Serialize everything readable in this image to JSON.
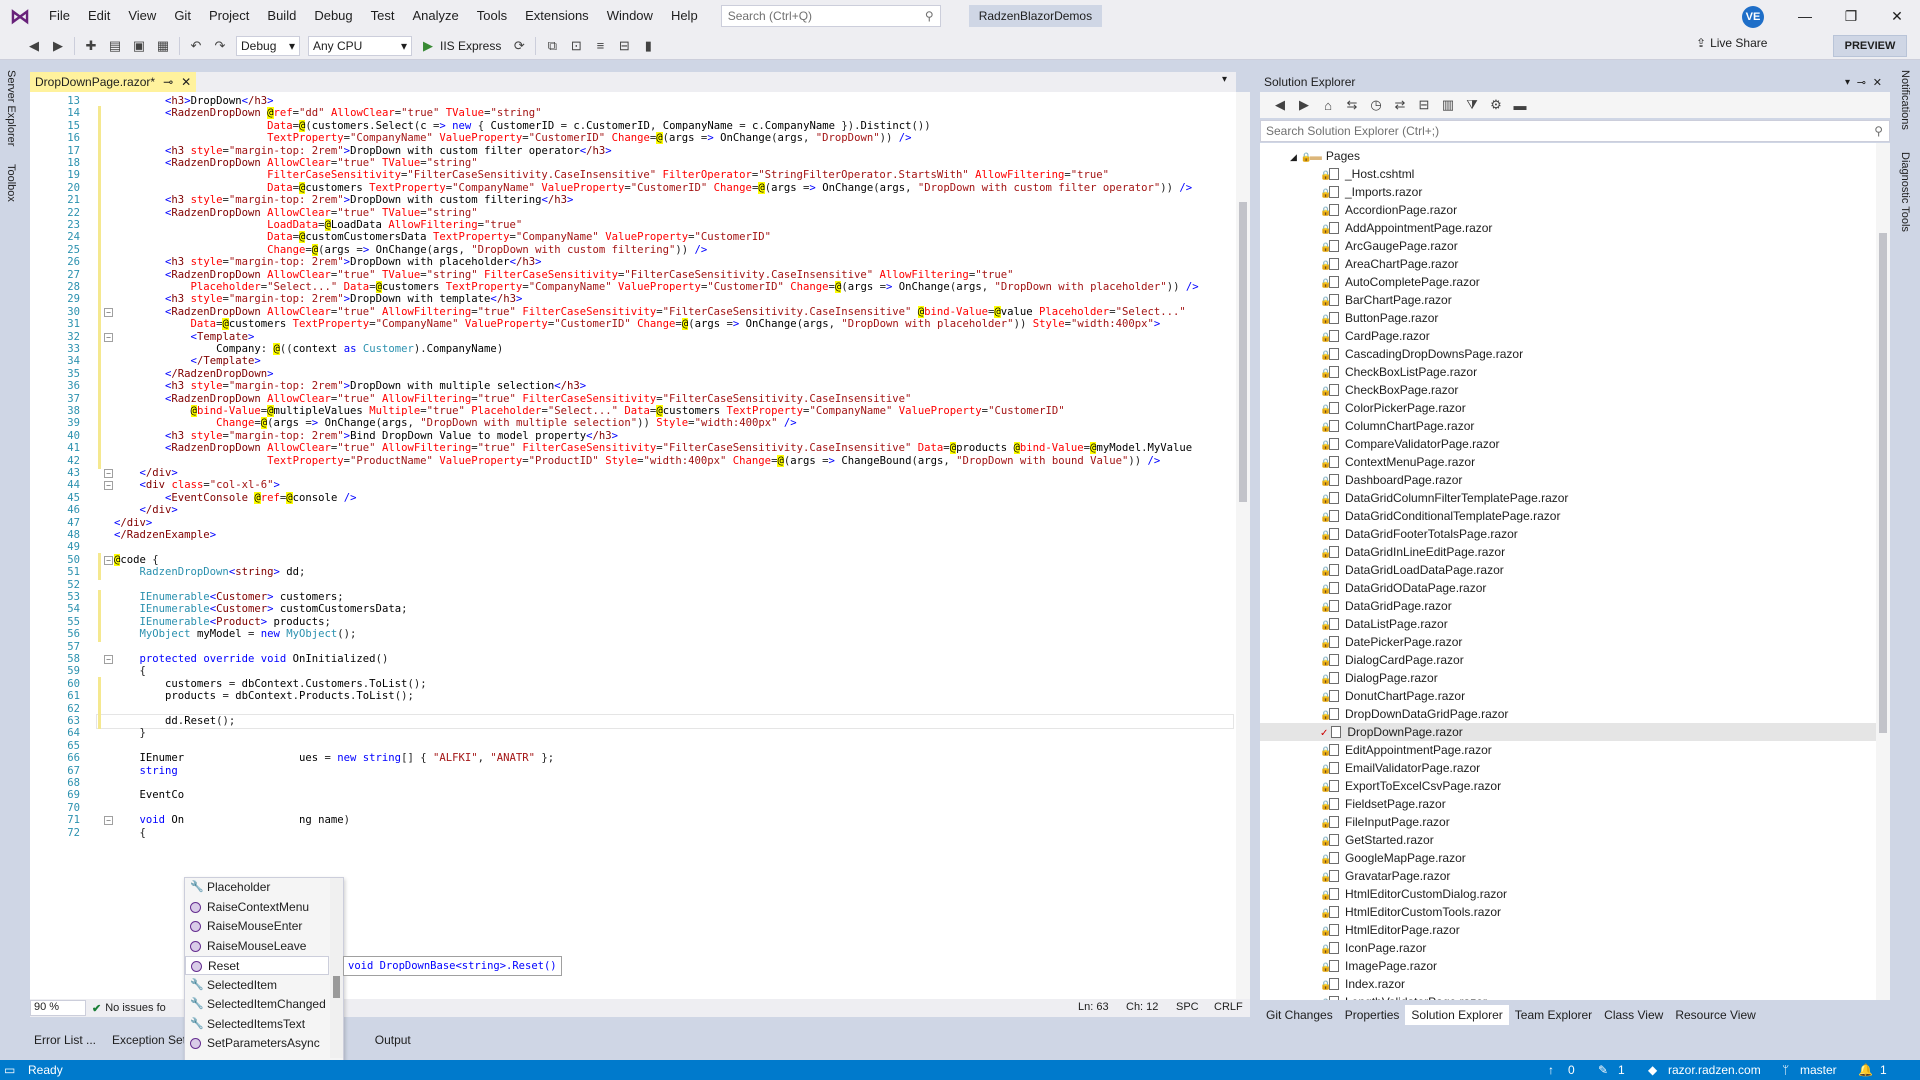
{
  "menu": {
    "items": [
      "File",
      "Edit",
      "View",
      "Git",
      "Project",
      "Build",
      "Debug",
      "Test",
      "Analyze",
      "Tools",
      "Extensions",
      "Window",
      "Help"
    ],
    "search_placeholder": "Search (Ctrl+Q)",
    "solution_name": "RadzenBlazorDemos",
    "user_initials": "VE"
  },
  "toolbar": {
    "config": "Debug",
    "platform": "Any CPU",
    "run_target": "IIS Express",
    "live_share": "Live Share",
    "preview": "PREVIEW"
  },
  "left_strip": {
    "tabs": [
      "Server Explorer",
      "Toolbox"
    ]
  },
  "right_strip": {
    "tabs": [
      "Notifications",
      "Diagnostic Tools"
    ]
  },
  "editor": {
    "tab_title": "DropDownPage.razor*",
    "zoom": "90 %",
    "issues": "No issues fo",
    "ln": "Ln: 63",
    "ch": "Ch: 12",
    "ins": "SPC",
    "eol": "CRLF",
    "lines": [
      {
        "n": "13",
        "t": "        <h3>DropDown</h3>"
      },
      {
        "n": "14",
        "t": "        <RadzenDropDown @ref=\"dd\" AllowClear=\"true\" TValue=\"string\""
      },
      {
        "n": "15",
        "t": "                        Data=@(customers.Select(c => new { CustomerID = c.CustomerID, CompanyName = c.CompanyName }).Distinct())"
      },
      {
        "n": "16",
        "t": "                        TextProperty=\"CompanyName\" ValueProperty=\"CustomerID\" Change=@(args => OnChange(args, \"DropDown\")) />"
      },
      {
        "n": "17",
        "t": "        <h3 style=\"margin-top: 2rem\">DropDown with custom filter operator</h3>"
      },
      {
        "n": "18",
        "t": "        <RadzenDropDown AllowClear=\"true\" TValue=\"string\""
      },
      {
        "n": "19",
        "t": "                        FilterCaseSensitivity=\"FilterCaseSensitivity.CaseInsensitive\" FilterOperator=\"StringFilterOperator.StartsWith\" AllowFiltering=\"true\""
      },
      {
        "n": "20",
        "t": "                        Data=@customers TextProperty=\"CompanyName\" ValueProperty=\"CustomerID\" Change=@(args => OnChange(args, \"DropDown with custom filter operator\")) />"
      },
      {
        "n": "21",
        "t": "        <h3 style=\"margin-top: 2rem\">DropDown with custom filtering</h3>"
      },
      {
        "n": "22",
        "t": "        <RadzenDropDown AllowClear=\"true\" TValue=\"string\""
      },
      {
        "n": "23",
        "t": "                        LoadData=@LoadData AllowFiltering=\"true\""
      },
      {
        "n": "24",
        "t": "                        Data=@customCustomersData TextProperty=\"CompanyName\" ValueProperty=\"CustomerID\""
      },
      {
        "n": "25",
        "t": "                        Change=@(args => OnChange(args, \"DropDown with custom filtering\")) />"
      },
      {
        "n": "26",
        "t": "        <h3 style=\"margin-top: 2rem\">DropDown with placeholder</h3>"
      },
      {
        "n": "27",
        "t": "        <RadzenDropDown AllowClear=\"true\" TValue=\"string\" FilterCaseSensitivity=\"FilterCaseSensitivity.CaseInsensitive\" AllowFiltering=\"true\""
      },
      {
        "n": "28",
        "t": "            Placeholder=\"Select...\" Data=@customers TextProperty=\"CompanyName\" ValueProperty=\"CustomerID\" Change=@(args => OnChange(args, \"DropDown with placeholder\")) />"
      },
      {
        "n": "29",
        "t": "        <h3 style=\"margin-top: 2rem\">DropDown with template</h3>"
      },
      {
        "n": "30",
        "t": "        <RadzenDropDown AllowClear=\"true\" AllowFiltering=\"true\" FilterCaseSensitivity=\"FilterCaseSensitivity.CaseInsensitive\" @bind-Value=@value Placeholder=\"Select...\""
      },
      {
        "n": "31",
        "t": "            Data=@customers TextProperty=\"CompanyName\" ValueProperty=\"CustomerID\" Change=@(args => OnChange(args, \"DropDown with placeholder\")) Style=\"width:400px\">"
      },
      {
        "n": "32",
        "t": "            <Template>"
      },
      {
        "n": "33",
        "t": "                Company: @((context as Customer).CompanyName)"
      },
      {
        "n": "34",
        "t": "            </Template>"
      },
      {
        "n": "35",
        "t": "        </RadzenDropDown>"
      },
      {
        "n": "36",
        "t": "        <h3 style=\"margin-top: 2rem\">DropDown with multiple selection</h3>"
      },
      {
        "n": "37",
        "t": "        <RadzenDropDown AllowClear=\"true\" AllowFiltering=\"true\" FilterCaseSensitivity=\"FilterCaseSensitivity.CaseInsensitive\""
      },
      {
        "n": "38",
        "t": "            @bind-Value=@multipleValues Multiple=\"true\" Placeholder=\"Select...\" Data=@customers TextProperty=\"CompanyName\" ValueProperty=\"CustomerID\""
      },
      {
        "n": "39",
        "t": "                Change=@(args => OnChange(args, \"DropDown with multiple selection\")) Style=\"width:400px\" />"
      },
      {
        "n": "40",
        "t": "        <h3 style=\"margin-top: 2rem\">Bind DropDown Value to model property</h3>"
      },
      {
        "n": "41",
        "t": "        <RadzenDropDown AllowClear=\"true\" AllowFiltering=\"true\" FilterCaseSensitivity=\"FilterCaseSensitivity.CaseInsensitive\" Data=@products @bind-Value=@myModel.MyValue"
      },
      {
        "n": "42",
        "t": "                        TextProperty=\"ProductName\" ValueProperty=\"ProductID\" Style=\"width:400px\" Change=@(args => ChangeBound(args, \"DropDown with bound Value\")) />"
      },
      {
        "n": "43",
        "t": "    </div>"
      },
      {
        "n": "44",
        "t": "    <div class=\"col-xl-6\">"
      },
      {
        "n": "45",
        "t": "        <EventConsole @ref=@console />"
      },
      {
        "n": "46",
        "t": "    </div>"
      },
      {
        "n": "47",
        "t": "</div>"
      },
      {
        "n": "48",
        "t": "</RadzenExample>"
      },
      {
        "n": "49",
        "t": ""
      },
      {
        "n": "50",
        "t": "@code {"
      },
      {
        "n": "51",
        "t": "    RadzenDropDown<string> dd;"
      },
      {
        "n": "52",
        "t": ""
      },
      {
        "n": "53",
        "t": "    IEnumerable<Customer> customers;"
      },
      {
        "n": "54",
        "t": "    IEnumerable<Customer> customCustomersData;"
      },
      {
        "n": "55",
        "t": "    IEnumerable<Product> products;"
      },
      {
        "n": "56",
        "t": "    MyObject myModel = new MyObject();"
      },
      {
        "n": "57",
        "t": ""
      },
      {
        "n": "58",
        "t": "    protected override void OnInitialized()"
      },
      {
        "n": "59",
        "t": "    {"
      },
      {
        "n": "60",
        "t": "        customers = dbContext.Customers.ToList();"
      },
      {
        "n": "61",
        "t": "        products = dbContext.Products.ToList();"
      },
      {
        "n": "62",
        "t": ""
      },
      {
        "n": "63",
        "t": "        dd.Reset();"
      },
      {
        "n": "64",
        "t": "    }"
      },
      {
        "n": "65",
        "t": ""
      },
      {
        "n": "66",
        "t": "    IEnumer                  ues = new string[] { \"ALFKI\", \"ANATR\" };"
      },
      {
        "n": "67",
        "t": "    string"
      },
      {
        "n": "68",
        "t": ""
      },
      {
        "n": "69",
        "t": "    EventCo"
      },
      {
        "n": "70",
        "t": ""
      },
      {
        "n": "71",
        "t": "    void On                  ng name)"
      },
      {
        "n": "72",
        "t": "    {"
      }
    ]
  },
  "intellisense": {
    "items": [
      "Placeholder",
      "RaiseContextMenu",
      "RaiseMouseEnter",
      "RaiseMouseLeave",
      "Reset",
      "SelectedItem",
      "SelectedItemChanged",
      "SelectedItemsText",
      "SetParametersAsync"
    ],
    "tooltip": "void DropDownBase<string>.Reset()"
  },
  "bottom_tabs": [
    "Error List ...",
    "Exception Settin",
    "Output"
  ],
  "solution_explorer": {
    "title": "Solution Explorer",
    "search_placeholder": "Search Solution Explorer (Ctrl+;)",
    "folder": "Pages",
    "files": [
      "_Host.cshtml",
      "_Imports.razor",
      "AccordionPage.razor",
      "AddAppointmentPage.razor",
      "ArcGaugePage.razor",
      "AreaChartPage.razor",
      "AutoCompletePage.razor",
      "BarChartPage.razor",
      "ButtonPage.razor",
      "CardPage.razor",
      "CascadingDropDownsPage.razor",
      "CheckBoxListPage.razor",
      "CheckBoxPage.razor",
      "ColorPickerPage.razor",
      "ColumnChartPage.razor",
      "CompareValidatorPage.razor",
      "ContextMenuPage.razor",
      "DashboardPage.razor",
      "DataGridColumnFilterTemplatePage.razor",
      "DataGridConditionalTemplatePage.razor",
      "DataGridFooterTotalsPage.razor",
      "DataGridInLineEditPage.razor",
      "DataGridLoadDataPage.razor",
      "DataGridODataPage.razor",
      "DataGridPage.razor",
      "DataListPage.razor",
      "DatePickerPage.razor",
      "DialogCardPage.razor",
      "DialogPage.razor",
      "DonutChartPage.razor",
      "DropDownDataGridPage.razor",
      "DropDownPage.razor",
      "EditAppointmentPage.razor",
      "EmailValidatorPage.razor",
      "ExportToExcelCsvPage.razor",
      "FieldsetPage.razor",
      "FileInputPage.razor",
      "GetStarted.razor",
      "GoogleMapPage.razor",
      "GravatarPage.razor",
      "HtmlEditorCustomDialog.razor",
      "HtmlEditorCustomTools.razor",
      "HtmlEditorPage.razor",
      "IconPage.razor",
      "ImagePage.razor",
      "Index.razor",
      "LengthValidatorPage.razor"
    ],
    "tabs": [
      "Git Changes",
      "Properties",
      "Solution Explorer",
      "Team Explorer",
      "Class View",
      "Resource View"
    ]
  },
  "statusbar": {
    "ready": "Ready",
    "up": "0",
    "edits": "1",
    "repo": "razor.radzen.com",
    "branch": "master",
    "notifications": "1"
  }
}
